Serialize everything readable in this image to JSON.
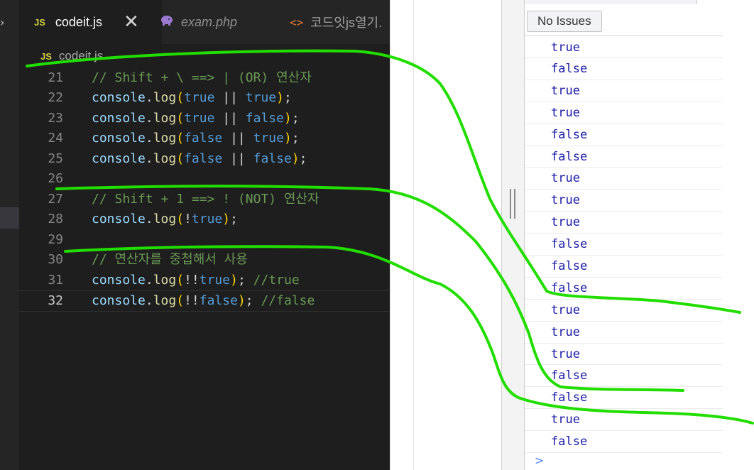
{
  "editor": {
    "tabs": [
      {
        "icon": "JS",
        "label": "codeit.js",
        "close": "✕",
        "active": true
      },
      {
        "icon": "php",
        "label": "exam.php",
        "active": false
      },
      {
        "icon": "<>",
        "label": "코드잇js열기.",
        "active": false
      }
    ],
    "breadcrumb": {
      "icon": "JS",
      "file": "codeit.js"
    },
    "lines": [
      {
        "num": "21",
        "tokens": [
          {
            "t": "// Shift + \\ ==> | (OR) 연산자",
            "c": "com"
          }
        ]
      },
      {
        "num": "22",
        "tokens": [
          {
            "t": "console",
            "c": "id"
          },
          {
            "t": ".",
            "c": "pun"
          },
          {
            "t": "log",
            "c": "fn"
          },
          {
            "t": "(",
            "c": "paren"
          },
          {
            "t": "true",
            "c": "kw"
          },
          {
            "t": " || ",
            "c": "pun"
          },
          {
            "t": "true",
            "c": "kw"
          },
          {
            "t": ")",
            "c": "paren"
          },
          {
            "t": ";",
            "c": "pun"
          }
        ]
      },
      {
        "num": "23",
        "tokens": [
          {
            "t": "console",
            "c": "id"
          },
          {
            "t": ".",
            "c": "pun"
          },
          {
            "t": "log",
            "c": "fn"
          },
          {
            "t": "(",
            "c": "paren"
          },
          {
            "t": "true",
            "c": "kw"
          },
          {
            "t": " || ",
            "c": "pun"
          },
          {
            "t": "false",
            "c": "kw"
          },
          {
            "t": ")",
            "c": "paren"
          },
          {
            "t": ";",
            "c": "pun"
          }
        ]
      },
      {
        "num": "24",
        "tokens": [
          {
            "t": "console",
            "c": "id"
          },
          {
            "t": ".",
            "c": "pun"
          },
          {
            "t": "log",
            "c": "fn"
          },
          {
            "t": "(",
            "c": "paren"
          },
          {
            "t": "false",
            "c": "kw"
          },
          {
            "t": " || ",
            "c": "pun"
          },
          {
            "t": "true",
            "c": "kw"
          },
          {
            "t": ")",
            "c": "paren"
          },
          {
            "t": ";",
            "c": "pun"
          }
        ]
      },
      {
        "num": "25",
        "tokens": [
          {
            "t": "console",
            "c": "id"
          },
          {
            "t": ".",
            "c": "pun"
          },
          {
            "t": "log",
            "c": "fn"
          },
          {
            "t": "(",
            "c": "paren"
          },
          {
            "t": "false",
            "c": "kw"
          },
          {
            "t": " || ",
            "c": "pun"
          },
          {
            "t": "false",
            "c": "kw"
          },
          {
            "t": ")",
            "c": "paren"
          },
          {
            "t": ";",
            "c": "pun"
          }
        ]
      },
      {
        "num": "26",
        "tokens": []
      },
      {
        "num": "27",
        "tokens": [
          {
            "t": "// Shift + 1 ==> ! (NOT) 연산자",
            "c": "com"
          }
        ]
      },
      {
        "num": "28",
        "tokens": [
          {
            "t": "console",
            "c": "id"
          },
          {
            "t": ".",
            "c": "pun"
          },
          {
            "t": "log",
            "c": "fn"
          },
          {
            "t": "(",
            "c": "paren"
          },
          {
            "t": "!",
            "c": "pun"
          },
          {
            "t": "true",
            "c": "kw"
          },
          {
            "t": ")",
            "c": "paren"
          },
          {
            "t": ";",
            "c": "pun"
          }
        ]
      },
      {
        "num": "29",
        "tokens": []
      },
      {
        "num": "30",
        "tokens": [
          {
            "t": "// 연산자를 중첩해서 사용",
            "c": "com"
          }
        ]
      },
      {
        "num": "31",
        "tokens": [
          {
            "t": "console",
            "c": "id"
          },
          {
            "t": ".",
            "c": "pun"
          },
          {
            "t": "log",
            "c": "fn"
          },
          {
            "t": "(",
            "c": "paren"
          },
          {
            "t": "!!",
            "c": "pun"
          },
          {
            "t": "true",
            "c": "kw"
          },
          {
            "t": ")",
            "c": "paren"
          },
          {
            "t": "; ",
            "c": "pun"
          },
          {
            "t": "//true",
            "c": "com"
          }
        ]
      },
      {
        "num": "32",
        "current": true,
        "tokens": [
          {
            "t": "console",
            "c": "id"
          },
          {
            "t": ".",
            "c": "pun"
          },
          {
            "t": "log",
            "c": "fn"
          },
          {
            "t": "(",
            "c": "paren"
          },
          {
            "t": "!!",
            "c": "pun"
          },
          {
            "t": "false",
            "c": "kw"
          },
          {
            "t": ")",
            "c": "paren"
          },
          {
            "t": "; ",
            "c": "pun"
          },
          {
            "t": "//false",
            "c": "com"
          }
        ]
      }
    ]
  },
  "devtools": {
    "issues_label": "No Issues",
    "prompt_icon": ">",
    "log_rows": [
      "true",
      "false",
      "true",
      "true",
      "false",
      "false",
      "true",
      "true",
      "true",
      "false",
      "false",
      "false",
      "true",
      "true",
      "true",
      "false",
      "false",
      "true",
      "false"
    ]
  },
  "colors": {
    "editor_bg": "#1e1e1e",
    "annotation_green": "#22dd00",
    "console_value": "#1a1aa6"
  }
}
